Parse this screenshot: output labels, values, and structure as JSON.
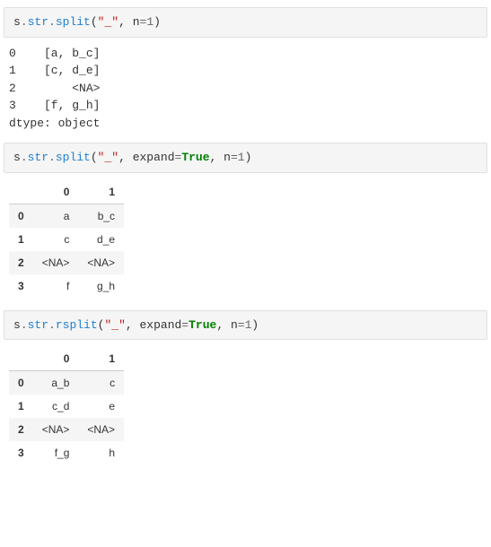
{
  "cell1": {
    "code": {
      "obj": "s",
      "dot1": ".",
      "attr1": "str",
      "dot2": ".",
      "attr2": "split",
      "lp": "(",
      "arg_str": "\"_\"",
      "comma": ", ",
      "kw_n": "n",
      "eq": "=",
      "num": "1",
      "rp": ")"
    },
    "output": "0    [a, b_c]\n1    [c, d_e]\n2        <NA>\n3    [f, g_h]\ndtype: object"
  },
  "cell2": {
    "code": {
      "obj": "s",
      "dot1": ".",
      "attr1": "str",
      "dot2": ".",
      "attr2": "split",
      "lp": "(",
      "arg_str": "\"_\"",
      "comma1": ", ",
      "kw_expand": "expand",
      "eq1": "=",
      "true": "True",
      "comma2": ", ",
      "kw_n": "n",
      "eq2": "=",
      "num": "1",
      "rp": ")"
    },
    "table": {
      "columns": [
        "0",
        "1"
      ],
      "index": [
        "0",
        "1",
        "2",
        "3"
      ],
      "rows": [
        [
          "a",
          "b_c"
        ],
        [
          "c",
          "d_e"
        ],
        [
          "<NA>",
          "<NA>"
        ],
        [
          "f",
          "g_h"
        ]
      ]
    }
  },
  "cell3": {
    "code": {
      "obj": "s",
      "dot1": ".",
      "attr1": "str",
      "dot2": ".",
      "attr2": "rsplit",
      "lp": "(",
      "arg_str": "\"_\"",
      "comma1": ", ",
      "kw_expand": "expand",
      "eq1": "=",
      "true": "True",
      "comma2": ", ",
      "kw_n": "n",
      "eq2": "=",
      "num": "1",
      "rp": ")"
    },
    "table": {
      "columns": [
        "0",
        "1"
      ],
      "index": [
        "0",
        "1",
        "2",
        "3"
      ],
      "rows": [
        [
          "a_b",
          "c"
        ],
        [
          "c_d",
          "e"
        ],
        [
          "<NA>",
          "<NA>"
        ],
        [
          "f_g",
          "h"
        ]
      ]
    }
  }
}
